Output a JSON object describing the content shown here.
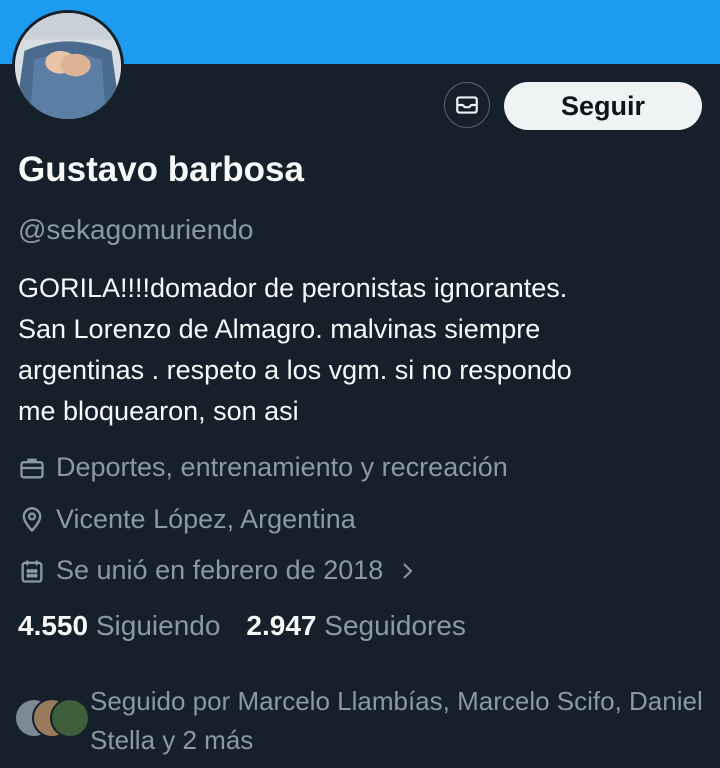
{
  "profile": {
    "name": "Gustavo barbosa",
    "handle": "@sekagomuriendo",
    "bio": "GORILA!!!!domador  de peronistas ignorantes.\nSan Lorenzo de Almagro.  malvinas siempre\nargentinas . respeto a los vgm.  si no respondo\nme bloquearon, son asi"
  },
  "actions": {
    "follow_label": "Seguir",
    "message_icon": "envelope-icon"
  },
  "meta": {
    "category": "Deportes, entrenamiento y recreación",
    "location": "Vicente López, Argentina",
    "joined": "Se unió en febrero de 2018"
  },
  "stats": {
    "following_count": "4.550",
    "following_label": "Siguiendo",
    "followers_count": "2.947",
    "followers_label": "Seguidores"
  },
  "followed_by": {
    "text": "Seguido por Marcelo Llambías, Marcelo Scifo, Daniel Stella y 2 más"
  },
  "colors": {
    "background": "#15202b",
    "banner": "#1d9bf0",
    "secondary_text": "#8b98a5",
    "button_bg": "#eff3f4"
  }
}
